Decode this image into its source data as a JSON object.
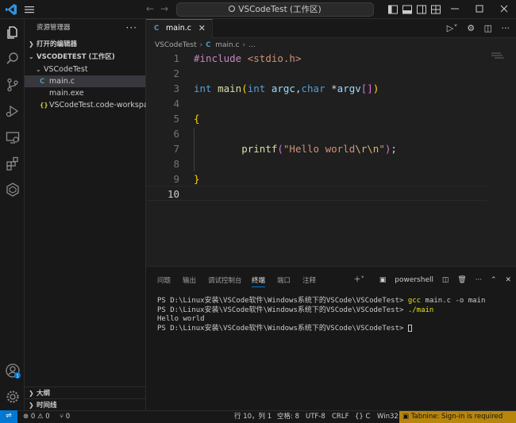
{
  "titlebar": {
    "search_text": "VSCodeTest (工作区)"
  },
  "sidebar": {
    "header": "资源管理器",
    "more": "···",
    "open_editors": "打开的编辑器",
    "workspace": "VSCODETEST (工作区)",
    "folder": "VSCodeTest",
    "files": [
      {
        "icon": "C",
        "name": "main.c"
      },
      {
        "icon": "",
        "name": "main.exe"
      },
      {
        "icon": "{}",
        "name": "VSCodeTest.code-workspace"
      }
    ],
    "outline": "大纲",
    "timeline": "时间线"
  },
  "tab": {
    "icon": "C",
    "label": "main.c",
    "close": "✕"
  },
  "breadcrumb": {
    "folder": "VSCodeTest",
    "icon": "C",
    "file": "main.c"
  },
  "editor": {
    "line_numbers": [
      "1",
      "2",
      "3",
      "4",
      "5",
      "6",
      "7",
      "8",
      "9",
      "10"
    ],
    "line1": {
      "directive": "#include",
      "header": "<stdio.h>"
    },
    "line3": {
      "type1": "int",
      "fn": "main",
      "p1": "(",
      "type2": "int",
      "arg1": "argc",
      "comma": ",",
      "type3": "char",
      "star": " *",
      "arg2": "argv",
      "p2": "[]",
      "p3": ")"
    },
    "line5": {
      "brace": "{"
    },
    "line7": {
      "fn": "printf",
      "p1": "(",
      "str1": "\"Hello world",
      "esc": "\\r\\n",
      "str2": "\"",
      "p2": ")",
      "semi": ";"
    },
    "line9": {
      "brace": "}"
    }
  },
  "panel": {
    "tabs": [
      "问题",
      "输出",
      "调试控制台",
      "终端",
      "端口",
      "注释"
    ],
    "active_tab": "终端",
    "shell": "powershell",
    "terminal": {
      "prompt": "PS D:\\Linux安装\\VSCode软件\\Windows系统下的VSCode\\VSCodeTest> ",
      "cmd1_name": "gcc",
      "cmd1_args": " main.c -o main",
      "cmd2": "./main",
      "output": "Hello world"
    }
  },
  "statusbar": {
    "remote": "⇌",
    "errors": "⊗ 0",
    "warnings": "⚠ 0",
    "ports": "⑂ 0",
    "position": "行 10，列 1",
    "spaces": "空格: 8",
    "encoding": "UTF-8",
    "eol": "CRLF",
    "language": "{} C",
    "platform": "Win32",
    "tabnine": "Tabnine: Sign-in is required"
  },
  "accounts_badge": "1",
  "colors": {
    "accent": "#0078d4",
    "tabnine_bg": "#b8860b"
  }
}
